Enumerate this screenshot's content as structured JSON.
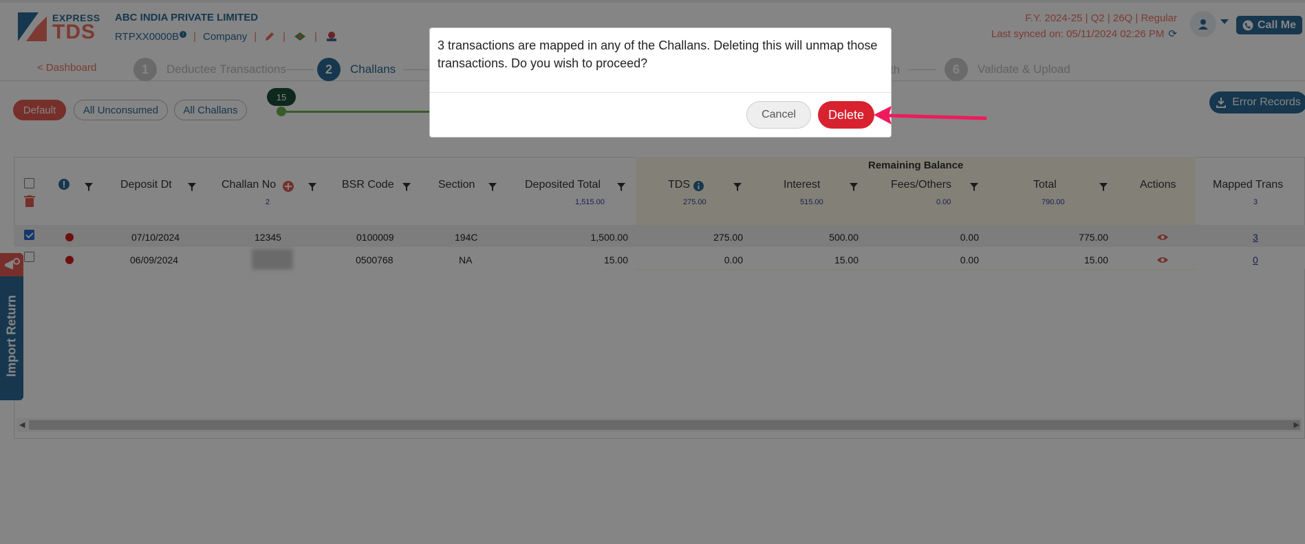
{
  "header": {
    "logo_line1": "EXPRESS",
    "logo_line2": "TDS",
    "company_name": "ABC INDIA PRIVATE LIMITED",
    "tan": "RTPXX0000B",
    "tan_info": "i",
    "entity_type": "Company",
    "separator": "|",
    "fy_line": "F.Y. 2024-25  | Q2  | 26Q | Regular",
    "sync_line": "Last synced on: 05/11/2024 02:26 PM",
    "call_me": "Call Me"
  },
  "stepper": {
    "dashboard_link": "< Dashboard",
    "steps": [
      {
        "num": "1",
        "label": "Deductee Transactions"
      },
      {
        "num": "2",
        "label": "Challans"
      },
      {
        "num": "6",
        "label": "Validate & Upload"
      }
    ],
    "partial_label": "th"
  },
  "filters": {
    "pills": [
      "Default",
      "All Unconsumed",
      "All Challans"
    ],
    "slider_value": "15",
    "error_records": "Error Records"
  },
  "table": {
    "group_header": "Remaining Balance",
    "columns": [
      {
        "label": "Deposit Dt",
        "sum": ""
      },
      {
        "label": "Challan No",
        "sum": "2"
      },
      {
        "label": "BSR Code",
        "sum": ""
      },
      {
        "label": "Section",
        "sum": ""
      },
      {
        "label": "Deposited Total",
        "sum": "1,515.00"
      },
      {
        "label": "TDS",
        "sum": "275.00"
      },
      {
        "label": "Interest",
        "sum": "515.00"
      },
      {
        "label": "Fees/Others",
        "sum": "0.00"
      },
      {
        "label": "Total",
        "sum": "790.00"
      },
      {
        "label": "Actions",
        "sum": ""
      },
      {
        "label": "Mapped Trans",
        "sum": "3"
      }
    ],
    "rows": [
      {
        "checked": true,
        "date": "07/10/2024",
        "challan": "12345",
        "bsr": "0100009",
        "section": "194C",
        "deposited": "1,500.00",
        "tds": "275.00",
        "interest": "500.00",
        "fees": "0.00",
        "total": "775.00",
        "mapped": "3"
      },
      {
        "checked": false,
        "date": "06/09/2024",
        "challan": "",
        "bsr": "0500768",
        "section": "NA",
        "deposited": "15.00",
        "tds": "0.00",
        "interest": "15.00",
        "fees": "0.00",
        "total": "15.00",
        "mapped": "0"
      }
    ]
  },
  "side_tab": {
    "label": "Import Return"
  },
  "modal": {
    "message": "3 transactions are mapped in any of the Challans. Deleting this will unmap those transactions. Do you wish to proceed?",
    "cancel_label": "Cancel",
    "delete_label": "Delete"
  },
  "colors": {
    "brand_blue": "#2b6a96",
    "brand_coral": "#f07060",
    "delete_red": "#d8222f",
    "arrow_pink": "#ee1b5b"
  }
}
